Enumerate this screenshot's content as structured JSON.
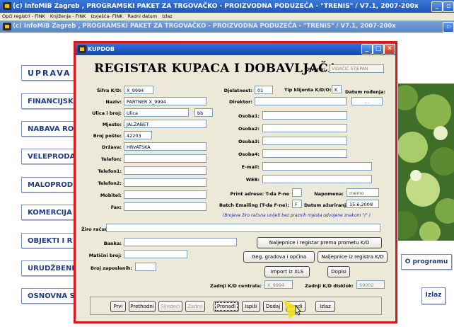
{
  "outer_window": {
    "title": "(c) InfoMiB Zagreb , PROGRAMSKI PAKET ZA TRGOVAČKO - PROIZVODNA PODUZEĆA - \"TRENIS\" / V7.1, 2007-200x"
  },
  "menu": {
    "items": [
      "Opći registri - FINK",
      "Knjiženja - FINK",
      "Izvješća- FINK",
      "Radni datum",
      "Izlaz"
    ]
  },
  "inner_window": {
    "title": "(c) InfoMiB Zagreb , PROGRAMSKI PAKET ZA TRGOVAČKO - PROIZVODNA PODUZEĆA - \"TRENIS\" / V7.1, 2007-200x"
  },
  "main_menu": [
    "UPRAVA",
    "FINANCIJSK",
    "NABAVA RO",
    "VELEPRODA",
    "MALOPROD",
    "KOMERCIJA",
    "OBJEKTI I R",
    "URUDŽBENI",
    "OSNOVNA S"
  ],
  "side_buttons": {
    "o_programu": "O programu",
    "izlaz": "Izlaz"
  },
  "dialog": {
    "title": "KUPDOB",
    "heading": "REGISTAR KUPACA I DOBAVLJAČA",
    "otvorio_label": "Otvorio:",
    "otvorio_value": "VIDAČIĆ STJEPAN",
    "fields": {
      "sifra_label": "Šifra K/D:",
      "sifra_value": "X_9994",
      "naziv_label": "Naziv:",
      "naziv_value": "PARTNER X_9994",
      "ulica_label": "Ulica i broj:",
      "ulica_value": "Ulica",
      "broj_value": "bb",
      "mjesto_label": "Mjesto:",
      "mjesto_value": "JALŽABET",
      "broj_poste_label": "Broj pošte:",
      "broj_poste_value": "42203",
      "drzava_label": "Država:",
      "drzava_value": "HRVATSKA",
      "telefon_label": "Telefon:",
      "telefon1_label": "Telefon1:",
      "telefon2_label": "Telefon2:",
      "mobitel_label": "Mobitel:",
      "fax_label": "Fax:",
      "djelatnost_label": "Djelatnost:",
      "djelatnost_value": "01",
      "tip_label": "Tip klijenta K/D/O:",
      "tip_value": "K",
      "datum_rodenja_label": "Datum rođenja:",
      "datum_rodenja_value": ". .",
      "direktor_label": "Direktor:",
      "osoba1_label": "Osoba1:",
      "osoba2_label": "Osoba2:",
      "osoba3_label": "Osoba3:",
      "osoba4_label": "Osoba4:",
      "email_label": "E-mail:",
      "web_label": "WEB:",
      "print_adrese_label": "Print adrese: T-da F-ne",
      "napomena_label": "Napomena:",
      "napomena_value": "memo",
      "batch_label": "Batch Emailing (T-da F-ne):",
      "batch_value": "F",
      "datum_azur_label": "Datum ažuriranja:",
      "datum_azur_value": "15.6.2008",
      "zirora_label": "Žiro račun:",
      "banka_label": "Banka:",
      "maticni_label": "Matični broj:",
      "broj_zaposlenih_label": "Broj zaposlenih:",
      "zadnji_centrala_label": "Zadnji K/D centrala:",
      "zadnji_centrala_value": "X_9994",
      "zadnji_dislok_label": "Zadnji K/D disklok:",
      "zadnji_dislok_value": "S9002"
    },
    "note": "(Brojeve žiro računa unijeti bez praznih mjesta odvojene znakom \"/\" )",
    "action_buttons": {
      "naljepnice_promet": "Naljepnice i registar prema prometu K/D",
      "geg_gradova": "Geg. gradova i općina",
      "naljepnice_registar": "Naljepnice iz registra K/D",
      "import_xls": "Import iz XLS",
      "dopisi": "Dopisi"
    },
    "nav_buttons": {
      "prvi": "Prvi",
      "prethodni": "Prethodni",
      "sljedeci": "Sljedeći",
      "zadnji": "Zadnji",
      "pronadi": "Pronađi",
      "ispis": "Ispiši",
      "dodaj": "Dodaj",
      "uredi": "Uredi",
      "izlaz": "Izlaz"
    }
  },
  "colors": {
    "dialog_border": "#e0121a",
    "menu_text": "#1e3d84",
    "title_bar": "#1e55b8"
  }
}
